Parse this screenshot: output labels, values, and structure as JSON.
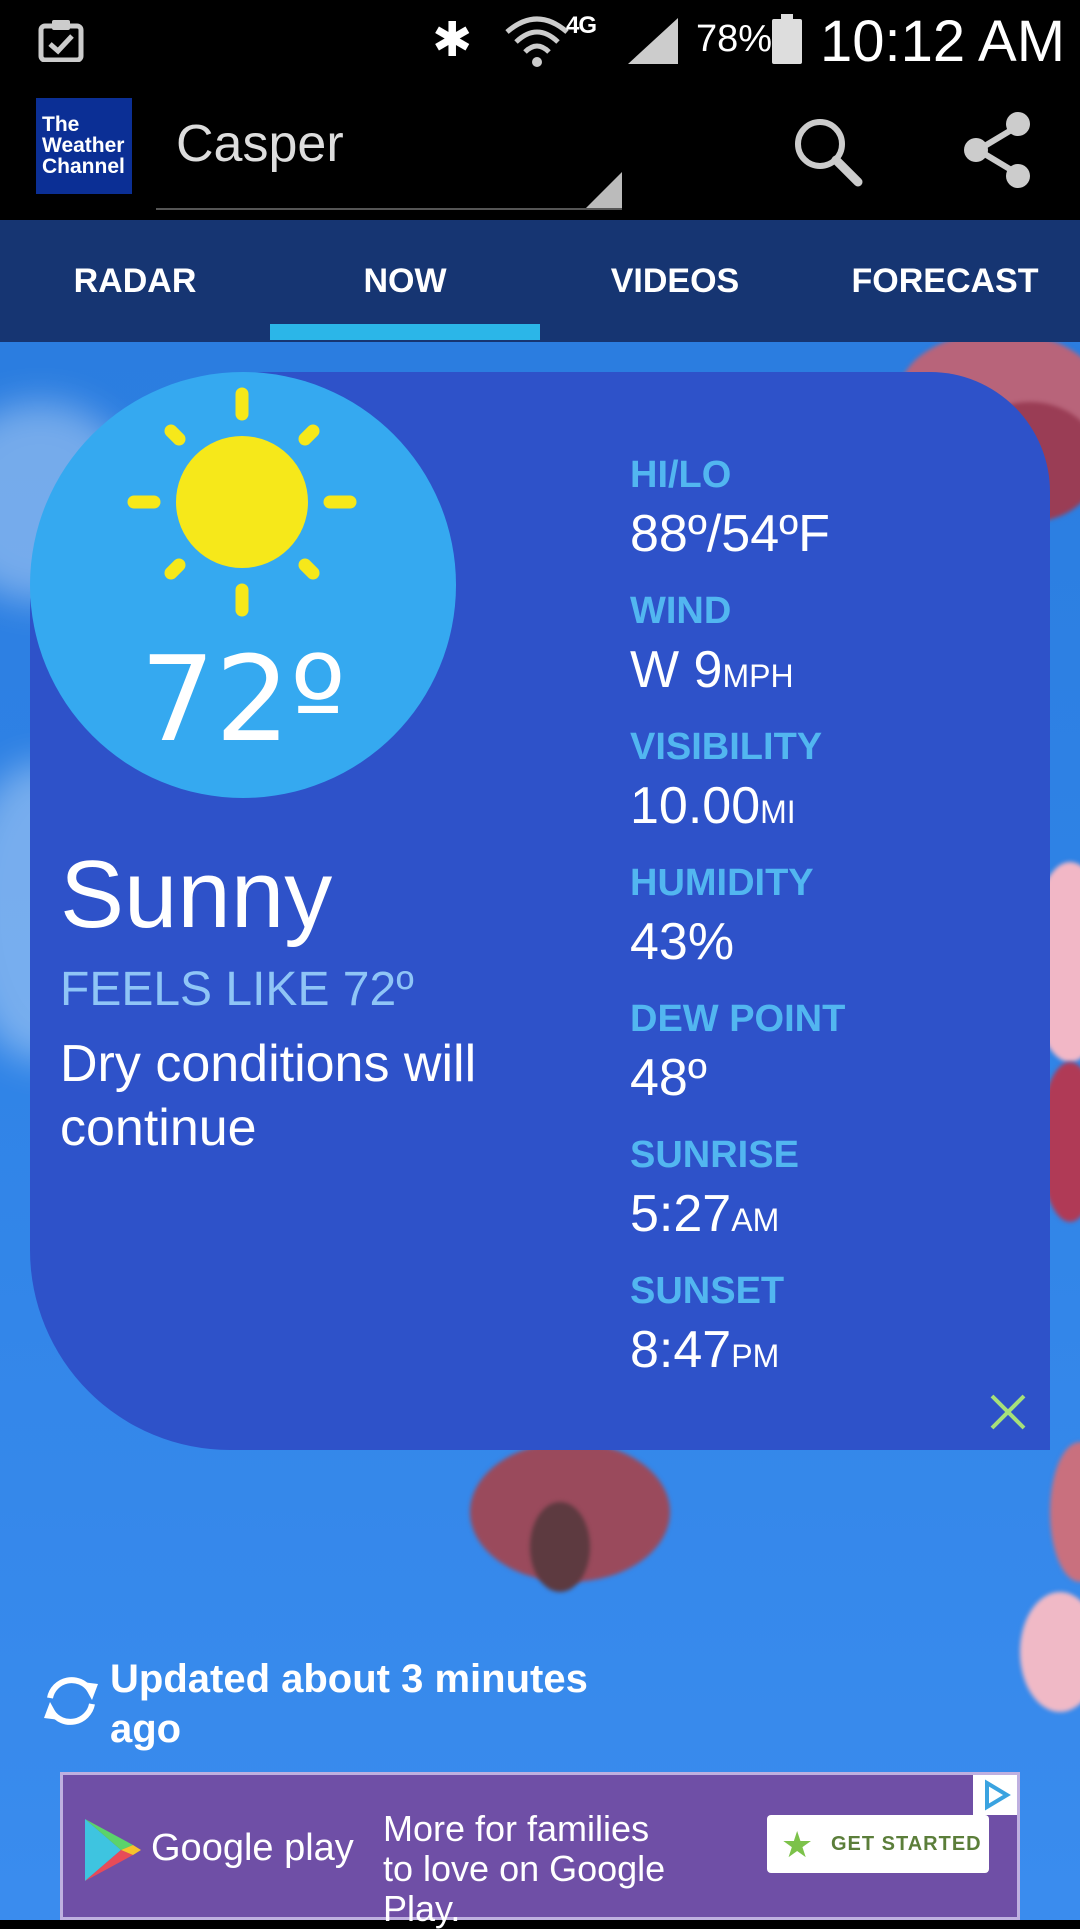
{
  "status_bar": {
    "network": "4G",
    "battery_percent": "78%",
    "time": "10:12 AM"
  },
  "app_bar": {
    "logo_text": "The Weather Channel",
    "city": "Casper"
  },
  "tabs": [
    {
      "label": "RADAR"
    },
    {
      "label": "NOW",
      "active": true
    },
    {
      "label": "VIDEOS"
    },
    {
      "label": "FORECAST"
    }
  ],
  "current": {
    "temp": "72º",
    "condition": "Sunny",
    "feels_like": "FEELS LIKE 72º",
    "description": "Dry conditions will continue"
  },
  "stats": {
    "hilo": {
      "label": "HI/LO",
      "value": "88º/54ºF"
    },
    "wind": {
      "label": "WIND",
      "value": "W 9",
      "unit": "MPH"
    },
    "visibility": {
      "label": "VISIBILITY",
      "value": "10.00",
      "unit": "MI"
    },
    "humidity": {
      "label": "HUMIDITY",
      "value": "43%"
    },
    "dew_point": {
      "label": "DEW POINT",
      "value": "48º"
    },
    "sunrise": {
      "label": "SUNRISE",
      "value": "5:27",
      "unit": "AM"
    },
    "sunset": {
      "label": "SUNSET",
      "value": "8:47",
      "unit": "PM"
    }
  },
  "updated": "Updated about 3 minutes ago",
  "ad": {
    "brand": "Google play",
    "text": "More for families to love on Google Play.",
    "button": "GET STARTED"
  },
  "colors": {
    "tab_bar": "#163572",
    "tab_indicator": "#2bb6e8",
    "card": "#2e52c9",
    "sun_circle": "#35a9f0",
    "stat_label": "#52b6f0"
  }
}
